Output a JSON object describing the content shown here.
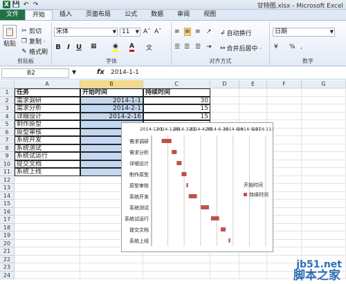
{
  "window": {
    "title": "甘特图.xlsx - Microsoft Excel"
  },
  "tabs": [
    "文件",
    "开始",
    "插入",
    "页面布局",
    "公式",
    "数据",
    "审阅",
    "视图"
  ],
  "ribbon": {
    "clipboard": {
      "paste": "粘贴",
      "cut": "剪切",
      "copy": "复制 ·",
      "format_painter": "格式刷",
      "label": "剪贴板"
    },
    "font": {
      "name": "宋体",
      "size": "11",
      "label": "字体",
      "bold": "B",
      "italic": "I",
      "underline": "U"
    },
    "alignment": {
      "wrap": "自动换行",
      "merge": "合并后居中 ·",
      "label": "对齐方式"
    },
    "number": {
      "format": "日期",
      "label": "数字",
      "currency": "¥",
      "percent": "%"
    }
  },
  "formula_bar": {
    "cell_ref": "B2",
    "fx": "fx",
    "value": "2014-1-1"
  },
  "columns": [
    "A",
    "B",
    "C",
    "D",
    "E",
    "F",
    "G"
  ],
  "rows": [
    "1",
    "2",
    "3",
    "4",
    "5",
    "6",
    "7",
    "8",
    "9",
    "10",
    "11",
    "12",
    "13",
    "14",
    "15",
    "16",
    "17",
    "18",
    "19",
    "20",
    "21",
    "22",
    "23",
    "24"
  ],
  "table": {
    "headers": [
      "任务",
      "开始时间",
      "持续时间"
    ],
    "rows": [
      [
        "需求调研",
        "2014-1-1",
        "30"
      ],
      [
        "需求分析",
        "2014-2-1",
        "15"
      ],
      [
        "详细设计",
        "2014-2-16",
        "15"
      ],
      [
        "制作原型",
        "",
        ""
      ],
      [
        "原型审核",
        "",
        ""
      ],
      [
        "系统开发",
        "",
        ""
      ],
      [
        "系统测试",
        "",
        ""
      ],
      [
        "系统试运行",
        "",
        ""
      ],
      [
        "提交文档",
        "",
        ""
      ],
      [
        "系统上线",
        "",
        ""
      ]
    ]
  },
  "chart_data": {
    "type": "bar",
    "x_ticks": [
      "2014-12-1",
      "2014-1-20",
      "2014-3-11",
      "2014-4-30",
      "2014-6-19",
      "2014-8-8",
      "2014-9-27",
      "2014-11-16"
    ],
    "categories": [
      "需求调研",
      "需求分析",
      "详细设计",
      "制作原型",
      "原型审核",
      "系统开发",
      "系统测试",
      "系统试运行",
      "提交文档",
      "系统上线"
    ],
    "series": [
      {
        "name": "开始时间",
        "color": "transparent",
        "values": [
          "2014-1-1",
          "2014-2-1",
          "2014-2-16",
          "2014-3-3",
          "2014-3-18",
          "2014-3-25",
          "2014-5-1",
          "2014-6-1",
          "2014-7-1",
          "2014-7-25"
        ]
      },
      {
        "name": "持续时间",
        "color": "#c0504d",
        "values": [
          30,
          15,
          15,
          15,
          5,
          25,
          25,
          25,
          15,
          5
        ]
      }
    ],
    "legend_position": "right"
  },
  "watermark": {
    "line1": "jb51.net",
    "line2": "脚本之家"
  }
}
